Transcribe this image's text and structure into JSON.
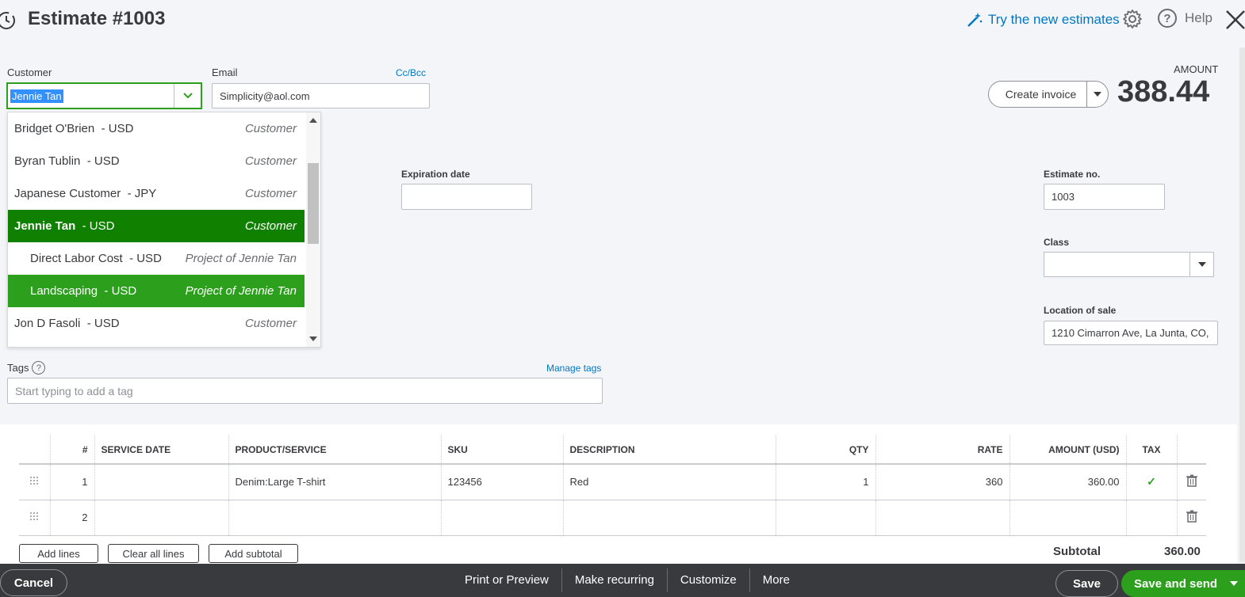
{
  "header": {
    "title": "Estimate #1003",
    "try_new": "Try the new estimates",
    "help": "Help"
  },
  "customer": {
    "label": "Customer",
    "value": "Jennie Tan"
  },
  "email": {
    "label": "Email",
    "value": "Simplicity@aol.com",
    "cc_bcc": "Cc/Bcc"
  },
  "dropdown": {
    "items": [
      {
        "name": "Bridget O'Brien",
        "currency": "- USD",
        "type": "Customer"
      },
      {
        "name": "Byran Tublin",
        "currency": "- USD",
        "type": "Customer"
      },
      {
        "name": "Japanese Customer",
        "currency": "- JPY",
        "type": "Customer"
      },
      {
        "name": "Jennie Tan",
        "currency": "- USD",
        "type": "Customer"
      },
      {
        "name": "Direct Labor Cost",
        "currency": "- USD",
        "type": "Project of Jennie Tan"
      },
      {
        "name": "Landscaping",
        "currency": "- USD",
        "type": "Project of Jennie Tan"
      },
      {
        "name": "Jon D Fasoli",
        "currency": "- USD",
        "type": "Customer"
      }
    ]
  },
  "amount": {
    "label": "AMOUNT",
    "value": "388.44",
    "create_invoice": "Create invoice"
  },
  "expiration": {
    "label": "Expiration date",
    "value": ""
  },
  "estimate_no": {
    "label": "Estimate no.",
    "value": "1003"
  },
  "class": {
    "label": "Class",
    "value": ""
  },
  "location": {
    "label": "Location of sale",
    "value": "1210 Cimarron Ave, La Junta, CO,"
  },
  "tags": {
    "label": "Tags",
    "manage": "Manage tags",
    "placeholder": "Start typing to add a tag"
  },
  "table": {
    "headers": [
      "#",
      "SERVICE DATE",
      "PRODUCT/SERVICE",
      "SKU",
      "DESCRIPTION",
      "QTY",
      "RATE",
      "AMOUNT (USD)",
      "TAX"
    ],
    "rows": [
      {
        "num": "1",
        "date": "",
        "product": "Denim:Large T-shirt",
        "sku": "123456",
        "desc": "Red",
        "qty": "1",
        "rate": "360",
        "amount": "360.00",
        "tax": "✓"
      },
      {
        "num": "2",
        "date": "",
        "product": "",
        "sku": "",
        "desc": "",
        "qty": "",
        "rate": "",
        "amount": "",
        "tax": ""
      }
    ]
  },
  "line_buttons": {
    "add_lines": "Add lines",
    "clear_all": "Clear all lines",
    "add_subtotal": "Add subtotal"
  },
  "subtotal": {
    "label": "Subtotal",
    "value": "360.00"
  },
  "footer": {
    "cancel": "Cancel",
    "print": "Print or Preview",
    "recurring": "Make recurring",
    "customize": "Customize",
    "more": "More",
    "save": "Save",
    "save_send": "Save and send"
  },
  "colors": {
    "accent_green": "#2ca01c",
    "dark_green": "#108000",
    "link_blue": "#0077c5",
    "footer_bg": "#393a3d"
  }
}
